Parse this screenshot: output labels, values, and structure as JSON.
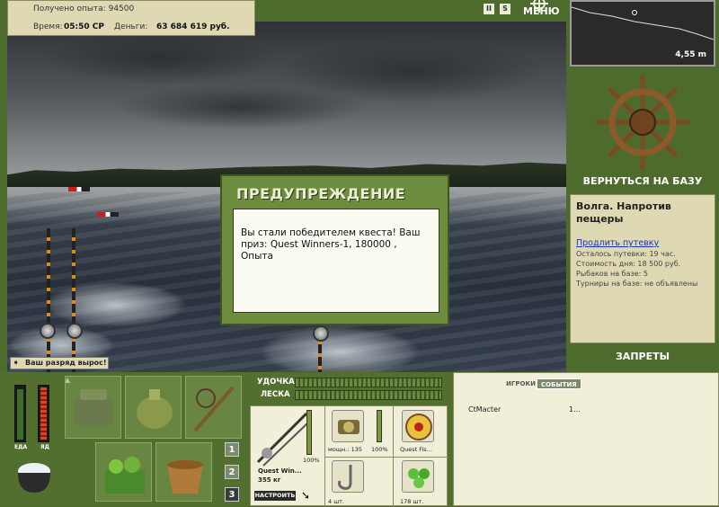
{
  "info": {
    "xp_label": "Получено опыта: 94500",
    "time_label": "Время:",
    "time_value": "05:50 СР",
    "money_label": "Деньги:",
    "money_value": "63 684 619 руб."
  },
  "top_controls": {
    "pause": "II",
    "sound": "S",
    "menu": "МЕНЮ"
  },
  "depth": {
    "value": "4,55 m"
  },
  "right_panel": {
    "back_button": "ВЕРНУТЬСЯ НА БАЗУ",
    "location_title": "Волга. Напротив пещеры",
    "extend_link": "Продлить путевку",
    "lines": [
      "Осталось путевки: 19 час.",
      "Стоимость дня: 18 500 руб.",
      "Рыбаков на базе: 5",
      "Турниры на базе: не объявлены"
    ],
    "bans_button": "ЗАПРЕТЫ"
  },
  "dialog": {
    "title": "ПРЕДУПРЕЖДЕНИЕ",
    "message": "Вы стали победителем квеста! Ваш приз: Quest Winners-1, 180000 , Опыта"
  },
  "rank_message": "Ваш разряд вырос!",
  "bottom": {
    "food_label": "ЕДА",
    "poison_label": "ЯД",
    "pages": [
      "1",
      "2",
      "3"
    ],
    "rod_label": "УДОЧКА",
    "line_label": "ЛЕСКА",
    "rod_name": "Quest Win...",
    "rod_weight": "355 кг",
    "rod_percent": "100%",
    "setup_button": "НАСТРОИТЬ",
    "reel_power": "мощн.: 135",
    "reel_percent": "100%",
    "line_name": "Quest Fis...",
    "hook_count": "4 шт.",
    "bait_count": "178 шт."
  },
  "chat": {
    "tab_players": "ИГРОКИ",
    "tab_events": "СОБЫТИЯ",
    "player_name": "CtMacter",
    "player_value": "1..."
  },
  "colors": {
    "panel_green": "#526f30",
    "panel_beige": "#ded9b3",
    "link_blue": "#1a37b3"
  }
}
